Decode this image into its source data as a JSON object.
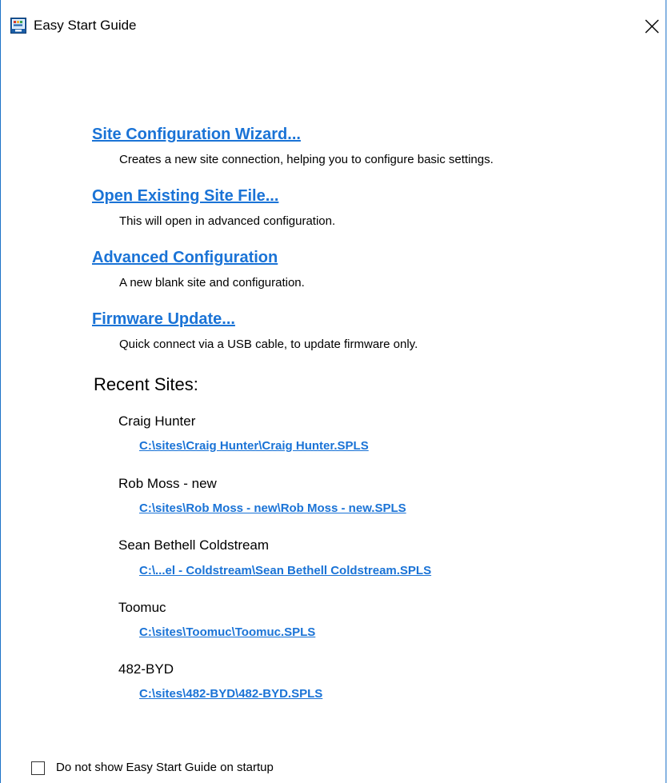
{
  "window": {
    "title": "Easy Start Guide",
    "icon": "monitor-app-icon",
    "close_icon": "close-icon"
  },
  "actions": [
    {
      "label": "Site Configuration Wizard...",
      "description": "Creates a new site connection, helping you to configure basic settings."
    },
    {
      "label": "Open Existing Site File...",
      "description": "This will open in advanced configuration."
    },
    {
      "label": "Advanced Configuration",
      "description": "A new blank site and configuration."
    },
    {
      "label": "Firmware Update...",
      "description": "Quick connect via a USB cable, to update firmware only."
    }
  ],
  "recent": {
    "heading": "Recent Sites:",
    "sites": [
      {
        "name": "Craig Hunter",
        "path": "C:\\sites\\Craig Hunter\\Craig Hunter.SPLS"
      },
      {
        "name": "Rob Moss - new",
        "path": "C:\\sites\\Rob Moss - new\\Rob Moss - new.SPLS"
      },
      {
        "name": "Sean Bethell Coldstream",
        "path": "C:\\...el - Coldstream\\Sean Bethell Coldstream.SPLS"
      },
      {
        "name": "Toomuc",
        "path": "C:\\sites\\Toomuc\\Toomuc.SPLS"
      },
      {
        "name": "482-BYD",
        "path": "C:\\sites\\482-BYD\\482-BYD.SPLS"
      }
    ]
  },
  "footer": {
    "checkbox_label": "Do not show Easy Start Guide on startup",
    "checked": false
  },
  "colors": {
    "link": "#1a73d6",
    "window_border": "#1e73c8"
  }
}
